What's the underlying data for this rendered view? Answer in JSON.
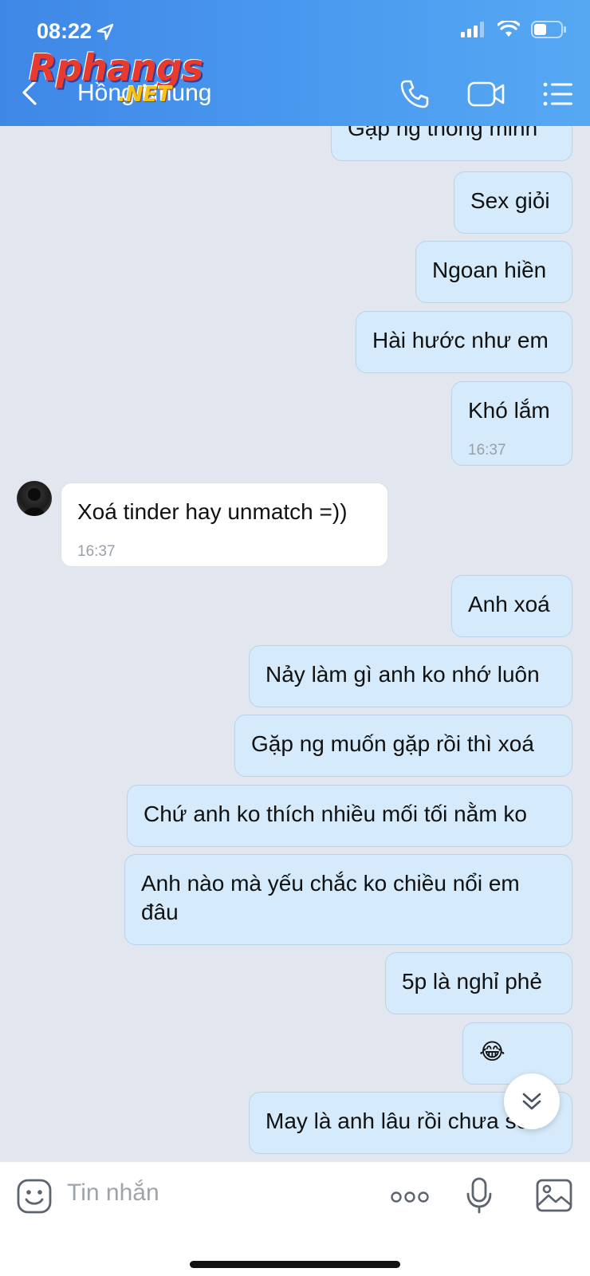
{
  "status_bar": {
    "time": "08:22"
  },
  "header": {
    "contact_name": "Hồng Nhung",
    "watermark_main": "Rphangs",
    "watermark_sub": ".NET"
  },
  "messages": [
    {
      "dir": "out",
      "text": "Gặp ng thông minh"
    },
    {
      "dir": "out",
      "text": "Sex giỏi"
    },
    {
      "dir": "out",
      "text": "Ngoan hiền"
    },
    {
      "dir": "out",
      "text": "Hài hước như em"
    },
    {
      "dir": "out",
      "text": "Khó lắm",
      "time": "16:37"
    },
    {
      "dir": "in",
      "text": "Xoá tinder hay unmatch =))",
      "time": "16:37"
    },
    {
      "dir": "out",
      "text": "Anh xoá"
    },
    {
      "dir": "out",
      "text": "Nảy làm gì anh ko nhớ luôn"
    },
    {
      "dir": "out",
      "text": "Gặp ng muốn gặp rồi thì xoá"
    },
    {
      "dir": "out",
      "text": "Chứ anh ko thích nhiều mối tối nằm ko"
    },
    {
      "dir": "out",
      "text": "Anh nào mà yếu chắc ko chiều nổi em đâu"
    },
    {
      "dir": "out",
      "text": "5p là nghỉ phẻ"
    },
    {
      "dir": "out",
      "text": "😂"
    },
    {
      "dir": "out",
      "text": "May là anh lâu rồi chưa sex"
    }
  ],
  "input": {
    "placeholder": "Tin nhắn"
  },
  "icons": {
    "back": "chevron-left-icon",
    "call": "phone-icon",
    "video": "video-icon",
    "menu": "list-icon",
    "sticker": "sticker-icon",
    "more": "more-icon",
    "mic": "microphone-icon",
    "image": "image-icon",
    "scroll": "scroll-down-icon"
  },
  "colors": {
    "header": "#4a9af0",
    "outgoing_bubble": "#d5ebfb",
    "incoming_bubble": "#ffffff",
    "chat_bg": "#e2e6ee"
  }
}
